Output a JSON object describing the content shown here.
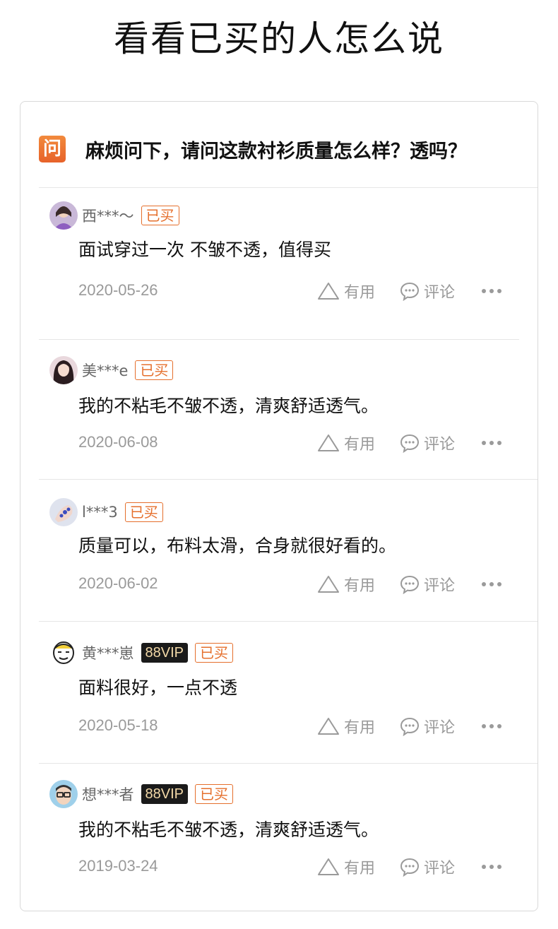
{
  "page": {
    "title": "看看已买的人怎么说"
  },
  "question": {
    "badge": "问",
    "text": "麻烦问下，请问这款衬衫质量怎么样？透吗？"
  },
  "labels": {
    "bought": "已买",
    "vip": "88VIP",
    "useful": "有用",
    "comment": "评论"
  },
  "answers": [
    {
      "user": "西***～",
      "vip": false,
      "text": "面试穿过一次 不皱不透，值得买",
      "date": "2020-05-26",
      "avatar": "girl-purple-avatar"
    },
    {
      "user": "美***e",
      "vip": false,
      "text": "我的不粘毛不皱不透，清爽舒适透气。",
      "date": "2020-06-08",
      "avatar": "girl-dark-hair-avatar"
    },
    {
      "user": "l***3",
      "vip": false,
      "text": "质量可以，布料太滑，合身就很好看的。",
      "date": "2020-06-02",
      "avatar": "hand-avatar"
    },
    {
      "user": "黄***崽",
      "vip": true,
      "text": "面料很好，一点不透",
      "date": "2020-05-18",
      "avatar": "cartoon-face-avatar"
    },
    {
      "user": "想***者",
      "vip": true,
      "text": "我的不粘毛不皱不透，清爽舒适透气。",
      "date": "2019-03-24",
      "avatar": "glasses-man-avatar"
    }
  ],
  "colors": {
    "accent": "#e56f2c",
    "text_gray": "#9a9a9a",
    "vip_bg": "#1a1a1a",
    "vip_text": "#f3d9a8"
  }
}
